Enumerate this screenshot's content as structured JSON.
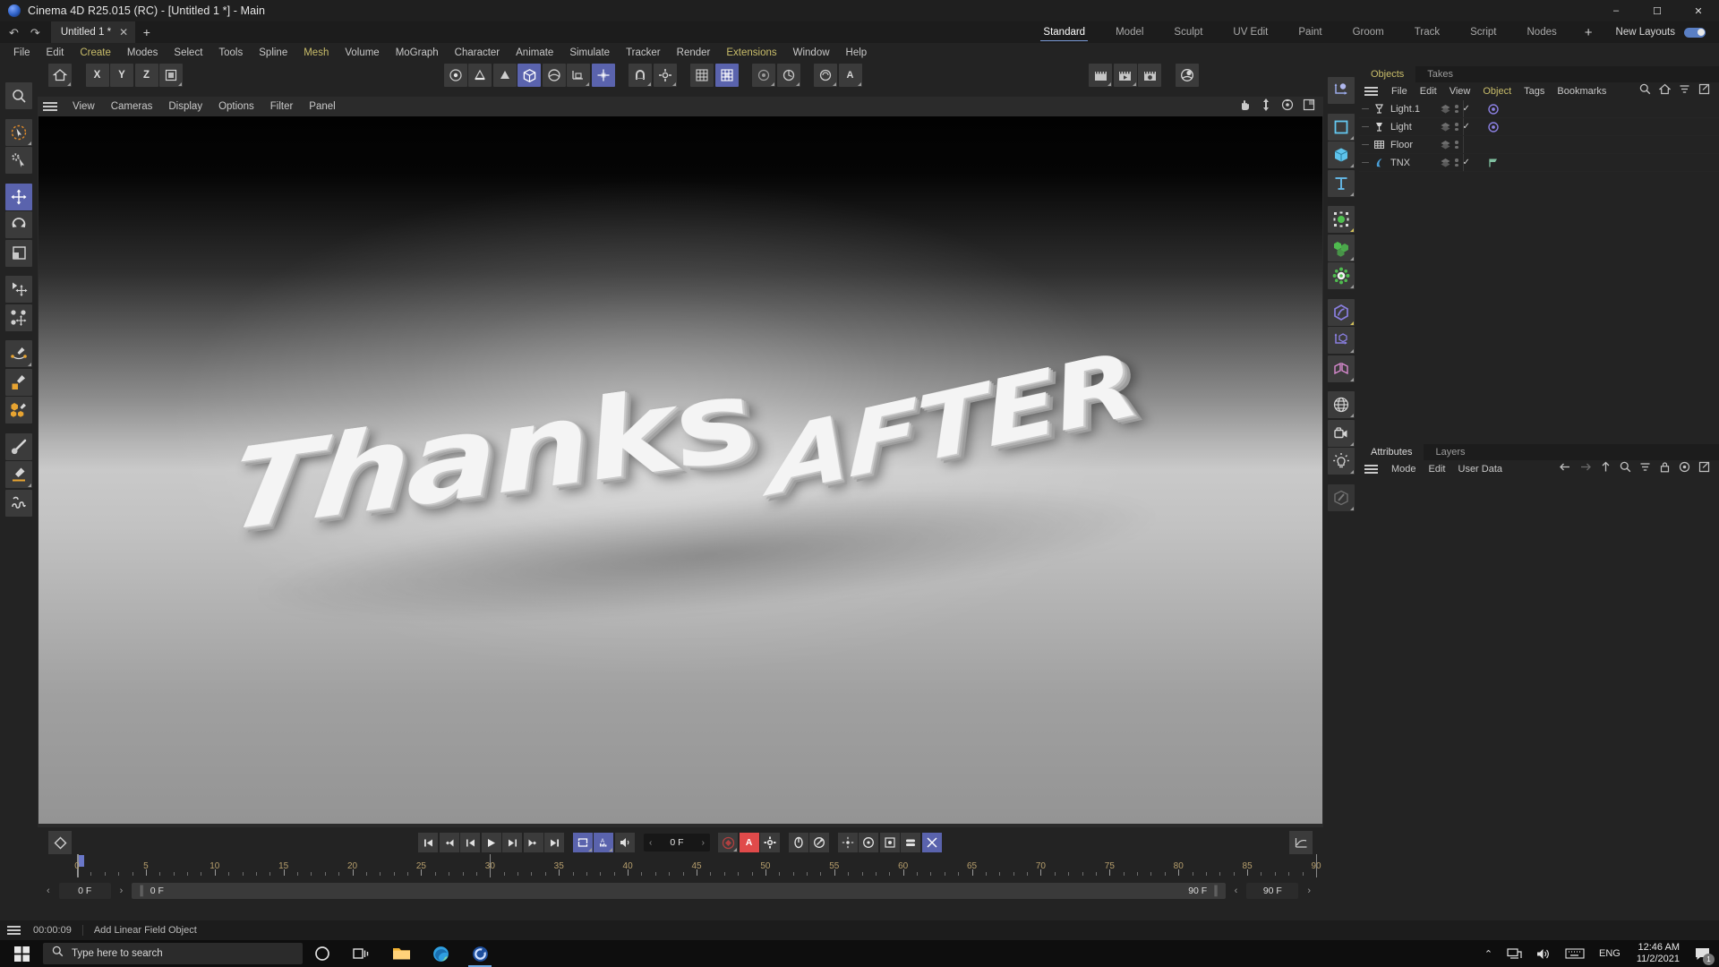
{
  "window": {
    "title": "Cinema 4D R25.015 (RC) - [Untitled 1 *] - Main",
    "minimize": "–",
    "maximize": "☐",
    "close": "✕"
  },
  "tabrow": {
    "undo": "undo-icon",
    "redo": "redo-icon",
    "document_tab": "Untitled 1 *",
    "tab_close": "✕",
    "new_tab": "+"
  },
  "layouts": {
    "tabs": [
      {
        "label": "Standard",
        "selected": true
      },
      {
        "label": "Model",
        "selected": false
      },
      {
        "label": "Sculpt",
        "selected": false
      },
      {
        "label": "UV Edit",
        "selected": false
      },
      {
        "label": "Paint",
        "selected": false
      },
      {
        "label": "Groom",
        "selected": false
      },
      {
        "label": "Track",
        "selected": false
      },
      {
        "label": "Script",
        "selected": false
      },
      {
        "label": "Nodes",
        "selected": false
      }
    ],
    "add": "+",
    "new_layouts_label": "New Layouts"
  },
  "menubar": {
    "items": [
      {
        "label": "File",
        "accent": false
      },
      {
        "label": "Edit",
        "accent": false
      },
      {
        "label": "Create",
        "accent": true
      },
      {
        "label": "Modes",
        "accent": false
      },
      {
        "label": "Select",
        "accent": false
      },
      {
        "label": "Tools",
        "accent": false
      },
      {
        "label": "Spline",
        "accent": false
      },
      {
        "label": "Mesh",
        "accent": true
      },
      {
        "label": "Volume",
        "accent": false
      },
      {
        "label": "MoGraph",
        "accent": false
      },
      {
        "label": "Character",
        "accent": false
      },
      {
        "label": "Animate",
        "accent": false
      },
      {
        "label": "Simulate",
        "accent": false
      },
      {
        "label": "Tracker",
        "accent": false
      },
      {
        "label": "Render",
        "accent": false
      },
      {
        "label": "Extensions",
        "accent": true
      },
      {
        "label": "Window",
        "accent": false
      },
      {
        "label": "Help",
        "accent": false
      }
    ]
  },
  "left_toolbar": {
    "groups": [
      [
        "search-icon"
      ],
      [
        "live-selection-icon",
        "cursor-settings-icon"
      ],
      [
        "move-tool-icon",
        "rotate-tool-icon",
        "scale-tool-icon"
      ],
      [
        "object-axis-move-icon",
        "points-move-icon"
      ],
      [
        "spline-pen-icon",
        "spline-rect-icon",
        "polygon-pen-icon"
      ],
      [
        "brush-icon",
        "edge-tool-icon",
        "knife-icon"
      ]
    ],
    "active": "move-tool-icon"
  },
  "command_bar": {
    "left_group": [
      "home-layout-icon"
    ],
    "axis_group": [
      "x-axis-lock",
      "y-axis-lock",
      "z-axis-lock",
      "world-axis"
    ],
    "axis_labels": {
      "x": "X",
      "y": "Y",
      "z": "Z"
    },
    "center_group": [
      "point-mode-icon",
      "edge-mode-icon",
      "polygon-mode-icon",
      "model-mode-icon",
      "texture-mode-icon",
      "workplane-icon",
      "enable-axis-icon"
    ],
    "snap_group": [
      "magnet-icon",
      "snap-settings-icon"
    ],
    "grid_group": [
      "grid-icon",
      "quantize-icon"
    ],
    "tool_group": [
      "viewport-solo-icon",
      "lock-icon"
    ],
    "right_group": [
      "render-region-icon",
      "render-char-icon"
    ],
    "render_group": [
      "render-view-icon",
      "render-picture-icon",
      "render-settings-icon"
    ],
    "scene_group": [
      "content-browser-icon"
    ],
    "active": "polygon-mode-icon",
    "active2": "enable-axis-icon"
  },
  "viewport": {
    "menu": [
      "View",
      "Cameras",
      "Display",
      "Options",
      "Filter",
      "Panel"
    ],
    "nav_icons": [
      "pan-icon",
      "dolly-icon",
      "orbit-icon",
      "maximize-view-icon"
    ],
    "scene_text_primary": "Thanks",
    "scene_text_secondary": "AFTER"
  },
  "timeline": {
    "keyframe_icon": "record-keyframe-icon",
    "transport": [
      "go-to-start-icon",
      "prev-key-icon",
      "prev-frame-icon",
      "play-icon",
      "next-frame-icon",
      "next-key-icon",
      "go-to-end-icon"
    ],
    "toggles": [
      "loop-icon",
      "auto-key-range-icon",
      "sound-icon"
    ],
    "frame_field": "0 F",
    "record_group": [
      "record-icon",
      "autokey-icon",
      "keyframe-settings-icon"
    ],
    "pos_group": [
      "position-key-icon",
      "rotation-key-icon"
    ],
    "anim_group": [
      "pos-scale-rot-icon",
      "rotation-icon",
      "param-icon",
      "pla-icon",
      "noik-icon"
    ],
    "graph_button": "timeline-graph-icon",
    "ruler": {
      "min": 0,
      "max": 90,
      "labels": [
        0,
        5,
        10,
        15,
        20,
        25,
        30,
        35,
        40,
        45,
        50,
        55,
        60,
        65,
        70,
        75,
        80,
        85,
        90
      ],
      "playhead_frame": 0,
      "current_marker_frame": 30
    },
    "left_field": "0 F",
    "left_bar_value": "0 F",
    "right_bar_value": "90 F",
    "right_field": "90 F",
    "prev_arrow": "‹",
    "next_arrow": "›"
  },
  "right_icons": {
    "items": [
      "null-object-icon",
      "spline-primitive-icon",
      "cube-primitive-icon",
      "text-spline-icon",
      "deformer-icon",
      "generator-icon",
      "mograph-icon",
      "field-icon",
      "workplane-axis-icon",
      "symmetry-icon",
      "environment-icon",
      "camera-icon",
      "light-icon",
      "material-edit-icon"
    ]
  },
  "object_manager": {
    "tabs": [
      {
        "label": "Objects",
        "selected": true
      },
      {
        "label": "Takes",
        "selected": false
      }
    ],
    "menu": [
      {
        "label": "File",
        "accent": false
      },
      {
        "label": "Edit",
        "accent": false
      },
      {
        "label": "View",
        "accent": false
      },
      {
        "label": "Object",
        "accent": true
      },
      {
        "label": "Tags",
        "accent": false
      },
      {
        "label": "Bookmarks",
        "accent": false
      }
    ],
    "tools": [
      "search-icon",
      "home-icon",
      "filter-icon",
      "open-external-icon"
    ],
    "objects": [
      {
        "name": "Light.1",
        "icon": "light-target-icon",
        "has_check": true,
        "tag": "light-tag-icon"
      },
      {
        "name": "Light",
        "icon": "light-icon",
        "has_check": true,
        "tag": "light-tag-icon"
      },
      {
        "name": "Floor",
        "icon": "floor-grid-icon",
        "has_check": false,
        "tag": ""
      },
      {
        "name": "TNX",
        "icon": "mograph-text-icon",
        "has_check": true,
        "tag": "flag-tag-icon"
      }
    ]
  },
  "attributes_manager": {
    "tabs": [
      {
        "label": "Attributes",
        "selected": true
      },
      {
        "label": "Layers",
        "selected": false
      }
    ],
    "menu": [
      {
        "label": "Mode",
        "accent": false
      },
      {
        "label": "Edit",
        "accent": false
      },
      {
        "label": "User Data",
        "accent": false
      }
    ],
    "tools": [
      "back-icon",
      "forward-icon",
      "up-icon",
      "search-icon",
      "filter-icon",
      "lock-icon",
      "pin-icon",
      "open-external-icon"
    ]
  },
  "status_bar": {
    "time": "00:00:09",
    "message": "Add Linear Field Object"
  },
  "taskbar": {
    "start_icon": "windows-start-icon",
    "search_placeholder": "Type here to search",
    "search_icon": "search-icon",
    "pinned": [
      {
        "name": "cortana-icon",
        "active": false
      },
      {
        "name": "task-view-icon",
        "active": false
      },
      {
        "name": "file-explorer-icon",
        "active": false
      },
      {
        "name": "microsoft-edge-icon",
        "active": false
      },
      {
        "name": "cinema4d-taskbar-icon",
        "active": true
      }
    ],
    "tray": {
      "expand": "⌃",
      "network_icon": "network-icon",
      "volume_icon": "volume-icon",
      "keyboard_icon": "keyboard-icon",
      "language": "ENG",
      "time": "12:46 AM",
      "date": "11/2/2021",
      "notifications": "1"
    }
  },
  "colors": {
    "accent_blue": "#5a63ad",
    "menu_yellow": "#c9bd6a",
    "panel_bg": "#232323",
    "button_bg": "#3b3b3b",
    "ruler_label": "#b79f6d"
  }
}
